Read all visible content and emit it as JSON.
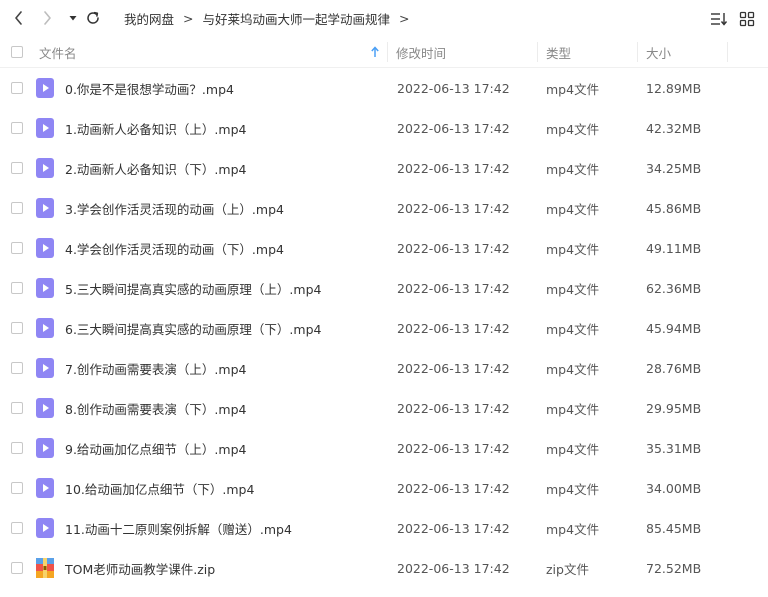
{
  "breadcrumb": [
    "我的网盘",
    "与好莱坞动画大师一起学动画规律"
  ],
  "breadcrumb_separator": ">",
  "columns": {
    "name": "文件名",
    "modified": "修改时间",
    "type": "类型",
    "size": "大小"
  },
  "icons": {
    "back": "chevron-left-icon",
    "forward": "chevron-right-icon",
    "history": "caret-down-icon",
    "refresh": "refresh-icon",
    "sort": "sort-list-icon",
    "view": "grid-view-icon",
    "video": "video-file-icon",
    "zip": "zip-archive-icon"
  },
  "colors": {
    "video_icon": "#8f86f4",
    "sort_arrow": "#4a9ff5"
  },
  "files": [
    {
      "name": "0.你是不是很想学动画？.mp4",
      "modified": "2022-06-13 17:42",
      "type": "mp4文件",
      "size": "12.89MB",
      "kind": "video"
    },
    {
      "name": "1.动画新人必备知识（上）.mp4",
      "modified": "2022-06-13 17:42",
      "type": "mp4文件",
      "size": "42.32MB",
      "kind": "video"
    },
    {
      "name": "2.动画新人必备知识（下）.mp4",
      "modified": "2022-06-13 17:42",
      "type": "mp4文件",
      "size": "34.25MB",
      "kind": "video"
    },
    {
      "name": "3.学会创作活灵活现的动画（上）.mp4",
      "modified": "2022-06-13 17:42",
      "type": "mp4文件",
      "size": "45.86MB",
      "kind": "video"
    },
    {
      "name": "4.学会创作活灵活现的动画（下）.mp4",
      "modified": "2022-06-13 17:42",
      "type": "mp4文件",
      "size": "49.11MB",
      "kind": "video"
    },
    {
      "name": "5.三大瞬间提高真实感的动画原理（上）.mp4",
      "modified": "2022-06-13 17:42",
      "type": "mp4文件",
      "size": "62.36MB",
      "kind": "video"
    },
    {
      "name": "6.三大瞬间提高真实感的动画原理（下）.mp4",
      "modified": "2022-06-13 17:42",
      "type": "mp4文件",
      "size": "45.94MB",
      "kind": "video"
    },
    {
      "name": "7.创作动画需要表演（上）.mp4",
      "modified": "2022-06-13 17:42",
      "type": "mp4文件",
      "size": "28.76MB",
      "kind": "video"
    },
    {
      "name": "8.创作动画需要表演（下）.mp4",
      "modified": "2022-06-13 17:42",
      "type": "mp4文件",
      "size": "29.95MB",
      "kind": "video"
    },
    {
      "name": "9.给动画加亿点细节（上）.mp4",
      "modified": "2022-06-13 17:42",
      "type": "mp4文件",
      "size": "35.31MB",
      "kind": "video"
    },
    {
      "name": "10.给动画加亿点细节（下）.mp4",
      "modified": "2022-06-13 17:42",
      "type": "mp4文件",
      "size": "34.00MB",
      "kind": "video"
    },
    {
      "name": "11.动画十二原则案例拆解（赠送）.mp4",
      "modified": "2022-06-13 17:42",
      "type": "mp4文件",
      "size": "85.45MB",
      "kind": "video"
    },
    {
      "name": "TOM老师动画教学课件.zip",
      "modified": "2022-06-13 17:42",
      "type": "zip文件",
      "size": "72.52MB",
      "kind": "zip"
    }
  ]
}
